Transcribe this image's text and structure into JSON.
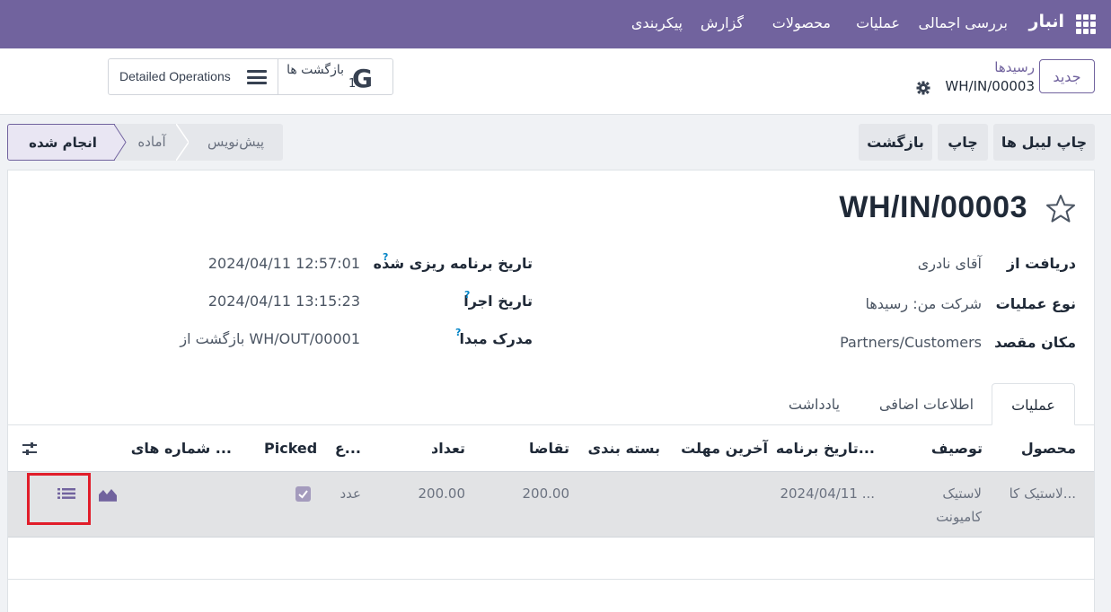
{
  "navbar": {
    "brand": "انبار",
    "menu": [
      "بررسی اجمالی",
      "عملیات",
      "محصولات",
      "گزارش",
      "پیکربندی"
    ]
  },
  "control": {
    "new_button": "جدید",
    "breadcrumb_parent": "رسیدها",
    "breadcrumb_current": "WH/IN/00003",
    "smart_returns_label": "بازگشت ها",
    "smart_returns_count": "1",
    "smart_detailed_label": "Detailed Operations"
  },
  "actions": {
    "print_labels": "چاپ لیبل ها",
    "print": "چاپ",
    "return": "بازگشت"
  },
  "status": {
    "done": "انجام شده",
    "ready": "آماده",
    "draft": "پیش‌نویس"
  },
  "form": {
    "title": "WH/IN/00003",
    "receive_from_label": "دریافت از",
    "receive_from_value": "آقای نادری",
    "operation_type_label": "نوع عملیات",
    "operation_type_value": "شرکت من: رسیدها",
    "destination_label": "مکان مقصد",
    "destination_value": "Partners/Customers",
    "scheduled_date_label": "تاریخ برنامه ریزی شده",
    "scheduled_date_value": "2024/04/11 12:57:01",
    "effective_date_label": "تاریخ اجرا",
    "effective_date_value": "2024/04/11 13:15:23",
    "source_doc_label": "مدرک مبدا",
    "source_doc_value": "بازگشت از WH/OUT/00001",
    "help_mark": "?"
  },
  "tabs": [
    "عملیات",
    "اطلاعات اضافی",
    "یادداشت"
  ],
  "table": {
    "headers": {
      "product": "محصول",
      "description": "توصیف",
      "scheduled": "تاریخ برنامه...",
      "deadline": "آخرین مهلت",
      "packaging": "بسته بندی",
      "demand": "تقاضا",
      "quantity": "تعداد",
      "uom": "ع...",
      "picked": "Picked",
      "serials": "شماره های ..."
    },
    "rows": [
      {
        "product": "لاستیک کا...",
        "description_line1": "لاستیک",
        "description_line2": "کامیونت",
        "scheduled": "2024/04/11 ...",
        "deadline": "",
        "packaging": "",
        "demand": "200.00",
        "quantity": "200.00",
        "uom": "عدد",
        "picked": true
      }
    ]
  },
  "colors": {
    "brand": "#71639e",
    "highlight": "#e11d2a"
  }
}
